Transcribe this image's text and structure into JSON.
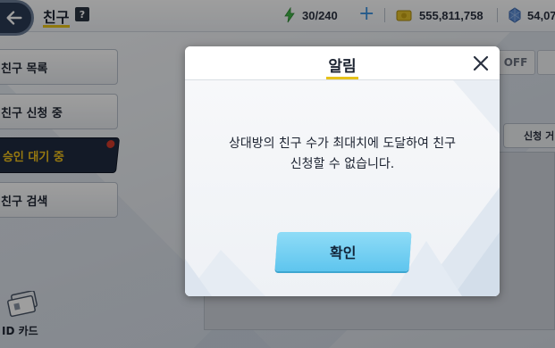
{
  "topbar": {
    "title": "친구",
    "help_label": "?",
    "stamina": "30/240",
    "gold": "555,811,758",
    "crystal": "54,07"
  },
  "sidebar": {
    "items": [
      {
        "label": "친구 목록"
      },
      {
        "label": "친구 신청 중"
      },
      {
        "label": "승인 대기 중"
      },
      {
        "label": "친구 검색"
      }
    ],
    "id_card_label": "ID 카드"
  },
  "background_panel": {
    "toggle_label": "OFF",
    "request_button_label": "신청 거"
  },
  "dialog": {
    "title": "알림",
    "message_line1": "상대방의 친구 수가 최대치에 도달하여 친구",
    "message_line2": "신청할 수 없습니다.",
    "confirm_label": "확인"
  },
  "colors": {
    "accent_yellow": "#e6c21a",
    "confirm_button": "#5ec5ee",
    "active_menu_bg": "#1f2b40",
    "notification_dot": "#d23a2a"
  }
}
